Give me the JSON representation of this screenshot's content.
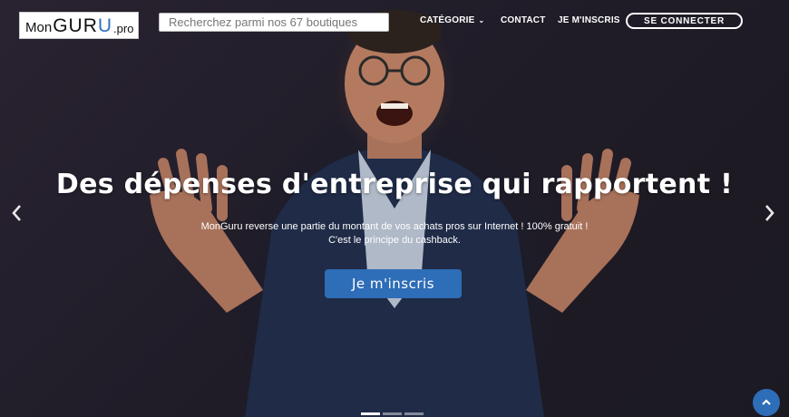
{
  "header": {
    "logo": {
      "mon": "Mon",
      "gu": "GU",
      "r": "R",
      "u": "U",
      "pro": ".pro"
    },
    "search": {
      "placeholder": "Recherchez parmi nos 67 boutiques"
    },
    "menu": {
      "category": "CATÉGORIE",
      "contact": "CONTACT",
      "signup": "JE M'INSCRIS",
      "login": "SE CONNECTER"
    }
  },
  "hero": {
    "headline": "Des dépenses d'entreprise qui rapportent !",
    "subtext": "MonGuru reverse une partie du montant de vos achats pros sur Internet ! 100% gratuit ! C'est le principe du cashback.",
    "cta": "Je m'inscris",
    "slides_total": 3,
    "slide_active": 1
  },
  "colors": {
    "accent": "#2e6db7",
    "logo_blue": "#2f6fc3"
  },
  "icons": {
    "prev": "chevron-left-icon",
    "next": "chevron-right-icon",
    "scroll_top": "chevron-up-icon",
    "dropdown": "chevron-down-icon"
  }
}
